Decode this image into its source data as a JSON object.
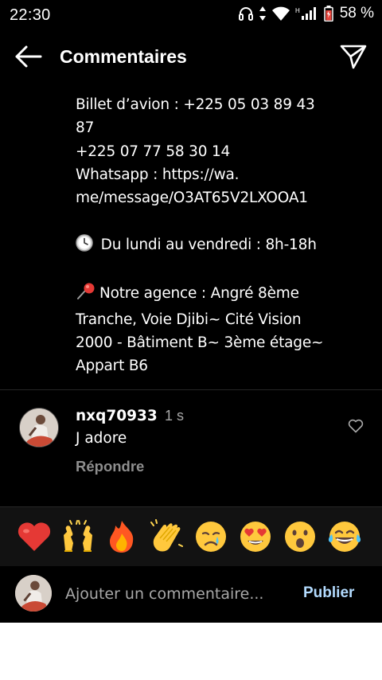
{
  "status_bar": {
    "time": "22:30",
    "battery": "58 %",
    "network_label": "H",
    "icons": [
      "headphones-icon",
      "data-arrows-icon",
      "wifi-icon",
      "signal-icon",
      "battery-icon"
    ]
  },
  "header": {
    "title": "Commentaires",
    "back_icon": "arrow-left-icon",
    "share_icon": "send-icon"
  },
  "caption": {
    "lines": [
      "Billet d’avion : +225 05 03 89 43",
      "87",
      "+225 07 77 58 30 14",
      "Whatsapp : https://wa.",
      "me/message/O3AT65V2LXOOA1",
      "",
      " Du lundi au vendredi : 8h-18h",
      "",
      "Notre agence : Angré 8ème",
      "Tranche, Voie Djibi~ Cité Vision",
      "2000 - Bâtiment B~ 3ème étage~",
      "Appart B6"
    ]
  },
  "comment": {
    "username": "nxq70933",
    "time": "1 s",
    "text": "J adore",
    "reply": "Répondre"
  },
  "emoji_bar": {
    "emojis": [
      "red-heart",
      "raising-hands",
      "fire",
      "clapping-hands",
      "crying-face",
      "heart-eyes-face",
      "astonished-face",
      "tears-of-joy-face"
    ]
  },
  "input_bar": {
    "placeholder": "Ajouter un commentaire...",
    "value": "",
    "post_label": "Publier"
  },
  "colors": {
    "background": "#000000",
    "muted_text": "#a8a8a8",
    "post_button": "#b3dbff"
  }
}
